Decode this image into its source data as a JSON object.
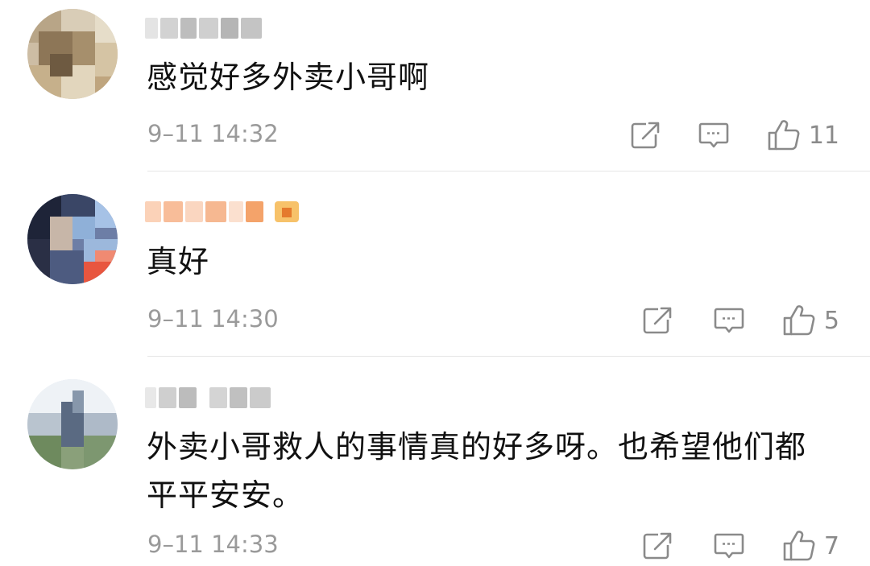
{
  "comments": [
    {
      "text": "感觉好多外卖小哥啊",
      "timestamp": "9–11 14:32",
      "likes": "11"
    },
    {
      "text": "真好",
      "timestamp": "9–11 14:30",
      "likes": "5"
    },
    {
      "text": "外卖小哥救人的事情真的好多呀。也希望他们都平平安安。",
      "timestamp": "9–11 14:33",
      "likes": "7"
    }
  ],
  "icons": {
    "share": "share-icon",
    "reply": "comment-icon",
    "like": "thumbs-up-icon"
  },
  "colors": {
    "text": "#111111",
    "meta": "#9a9a9a",
    "icon": "#8a8a8a",
    "divider": "#e6e6e6",
    "vip_username": "#f4a36a"
  }
}
